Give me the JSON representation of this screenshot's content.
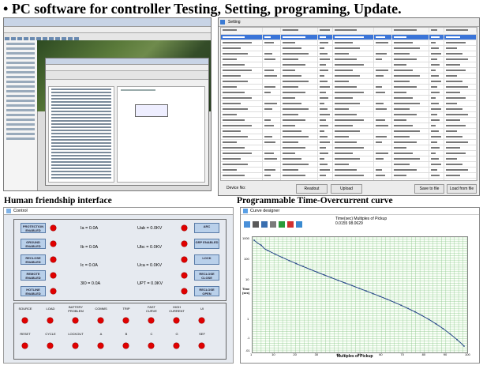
{
  "header": {
    "bullet": "•",
    "title": "PC software for controller Testing, Setting, programing, Update."
  },
  "panels": {
    "control_caption": "Human friendship interface",
    "curve_caption": "Programmable Time-Overcurrent curve"
  },
  "settings_window": {
    "title": "Setting",
    "buttons": [
      "Readout",
      "Upload",
      "Save to file",
      "Load from file"
    ],
    "device_label": "Device No:"
  },
  "control_window": {
    "title": "Control",
    "left_buttons": [
      "PROTECTION ENABLED",
      "GROUND ENABLED",
      "RECLOSE ENABLED",
      "REMOTE ENABLED",
      "HOTLINE ENABLED"
    ],
    "right_buttons": [
      "ARC",
      "GRP ENABLED",
      "LOCK",
      "RECLOSE CLOSE",
      "RECLOSE OPEN"
    ],
    "measurements_left": [
      "Ia =   0.0A",
      "Ib =   0.0A",
      "Ic =   0.0A",
      "3I0 =   0.0A"
    ],
    "measurements_right": [
      "Uab =   0.0KV",
      "Ubc =   0.0KV",
      "Uca =   0.0KV",
      "UPT =   0.0KV"
    ],
    "status_row1": [
      "SOURCE",
      "LOAD",
      "BATTERY PROBLEM",
      "COMMS",
      "TRIP",
      "FAST CURVE",
      "HIGH CURRENT",
      "UI"
    ],
    "status_row2": [
      "RESET",
      "CYCLE",
      "LOCKOUT",
      "A",
      "B",
      "C",
      "G",
      "SEF"
    ]
  },
  "curve_window": {
    "title": "Curve designer",
    "readout_labels": "Time(sec)  Multiples of Pickup",
    "readout_values": "0.0155    98.0629",
    "y_axis_label": "Time (sec)",
    "x_axis_label": "Multiples of Pickup",
    "y_ticks": [
      "1000",
      "100",
      "10",
      "1",
      ".1",
      ".01"
    ],
    "x_ticks": [
      "1",
      "10",
      "20",
      "30",
      "40",
      "50",
      "60",
      "70",
      "80",
      "90",
      "100"
    ]
  }
}
